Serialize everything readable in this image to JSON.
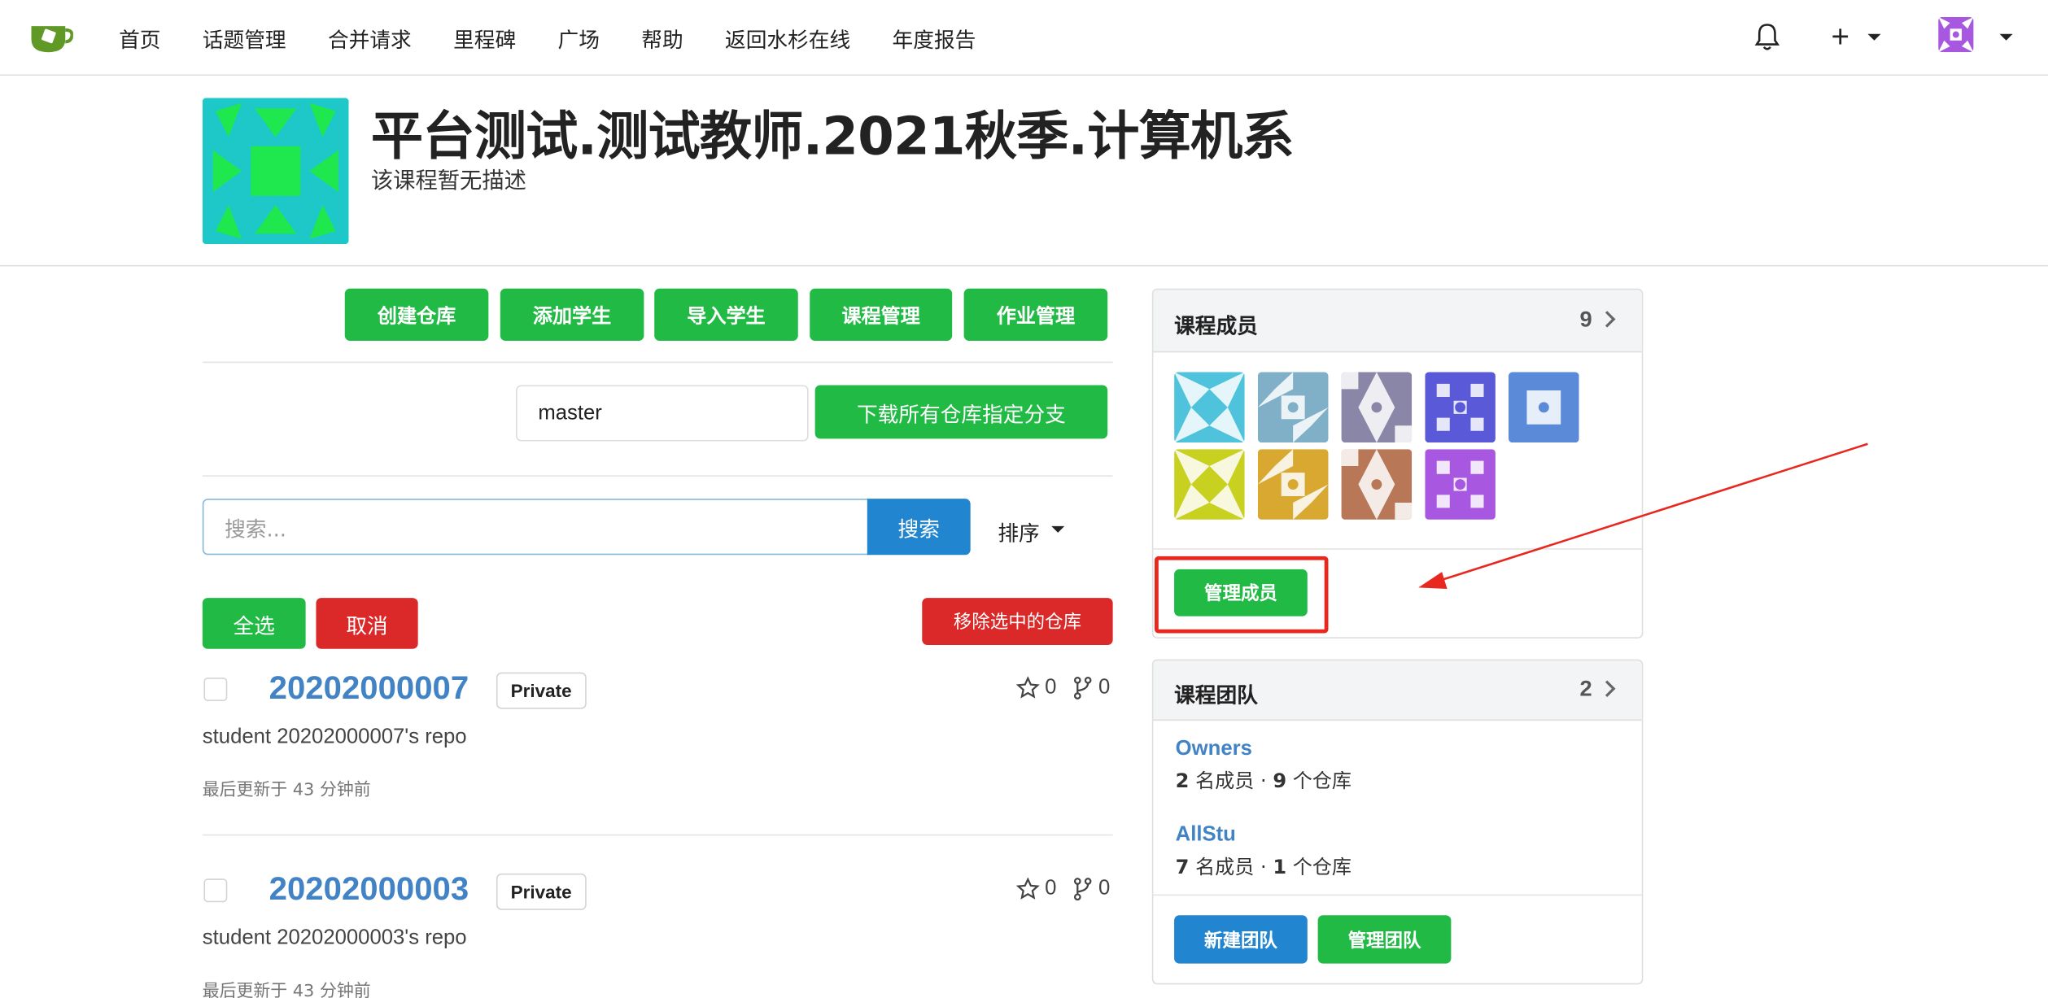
{
  "nav": {
    "items": [
      "首页",
      "话题管理",
      "合并请求",
      "里程碑",
      "广场",
      "帮助",
      "返回水杉在线",
      "年度报告"
    ],
    "plus": "+"
  },
  "course": {
    "title": "平台测试.测试教师.2021秋季.计算机系",
    "description": "该课程暂无描述"
  },
  "actions": [
    "创建仓库",
    "添加学生",
    "导入学生",
    "课程管理",
    "作业管理"
  ],
  "branch": {
    "value": "master",
    "download_label": "下载所有仓库指定分支"
  },
  "search": {
    "placeholder": "搜索...",
    "button": "搜索",
    "sort_label": "排序"
  },
  "bulk": {
    "select_all": "全选",
    "cancel": "取消",
    "remove": "移除选中的仓库"
  },
  "repos": [
    {
      "name": "20202000007",
      "visibility": "Private",
      "stars": "0",
      "forks": "0",
      "description": "student 20202000007's repo",
      "updated": "最后更新于 43 分钟前"
    },
    {
      "name": "20202000003",
      "visibility": "Private",
      "stars": "0",
      "forks": "0",
      "description": "student 20202000003's repo",
      "updated": "最后更新于 43 分钟前"
    }
  ],
  "members_card": {
    "title": "课程成员",
    "count": "9",
    "manage_label": "管理成员",
    "avatar_colors": [
      "#4fc3dc",
      "#7fb0c8",
      "#8a86a8",
      "#5a5ad8",
      "#5a8ad8",
      "#c8d020",
      "#d8a830",
      "#b87858",
      "#a858e0"
    ]
  },
  "teams_card": {
    "title": "课程团队",
    "count": "2",
    "teams": [
      {
        "name": "Owners",
        "members": "2",
        "members_suffix": "名成员 ·",
        "repos": "9",
        "repos_suffix": "个仓库"
      },
      {
        "name": "AllStu",
        "members": "7",
        "members_suffix": "名成员 ·",
        "repos": "1",
        "repos_suffix": "个仓库"
      }
    ],
    "new_label": "新建团队",
    "manage_label": "管理团队"
  },
  "colors": {
    "green": "#21ba45",
    "red": "#db2828",
    "blue": "#2185d0",
    "link": "#4183c4",
    "annotation": "#e8281e"
  }
}
